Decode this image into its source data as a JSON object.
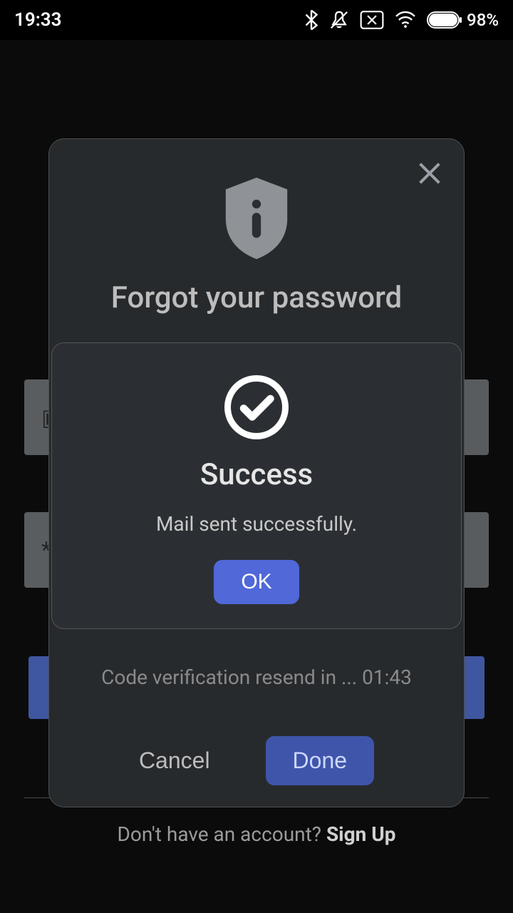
{
  "status": {
    "time": "19:33",
    "battery_pct": "98%"
  },
  "footer": {
    "prompt": "Don't have an account? ",
    "cta": "Sign Up"
  },
  "forgot": {
    "title": "Forgot your password",
    "resend": "Code verification resend in ... 01:43",
    "cancel": "Cancel",
    "done": "Done"
  },
  "success": {
    "title": "Success",
    "message": "Mail sent successfully.",
    "ok": "OK"
  }
}
